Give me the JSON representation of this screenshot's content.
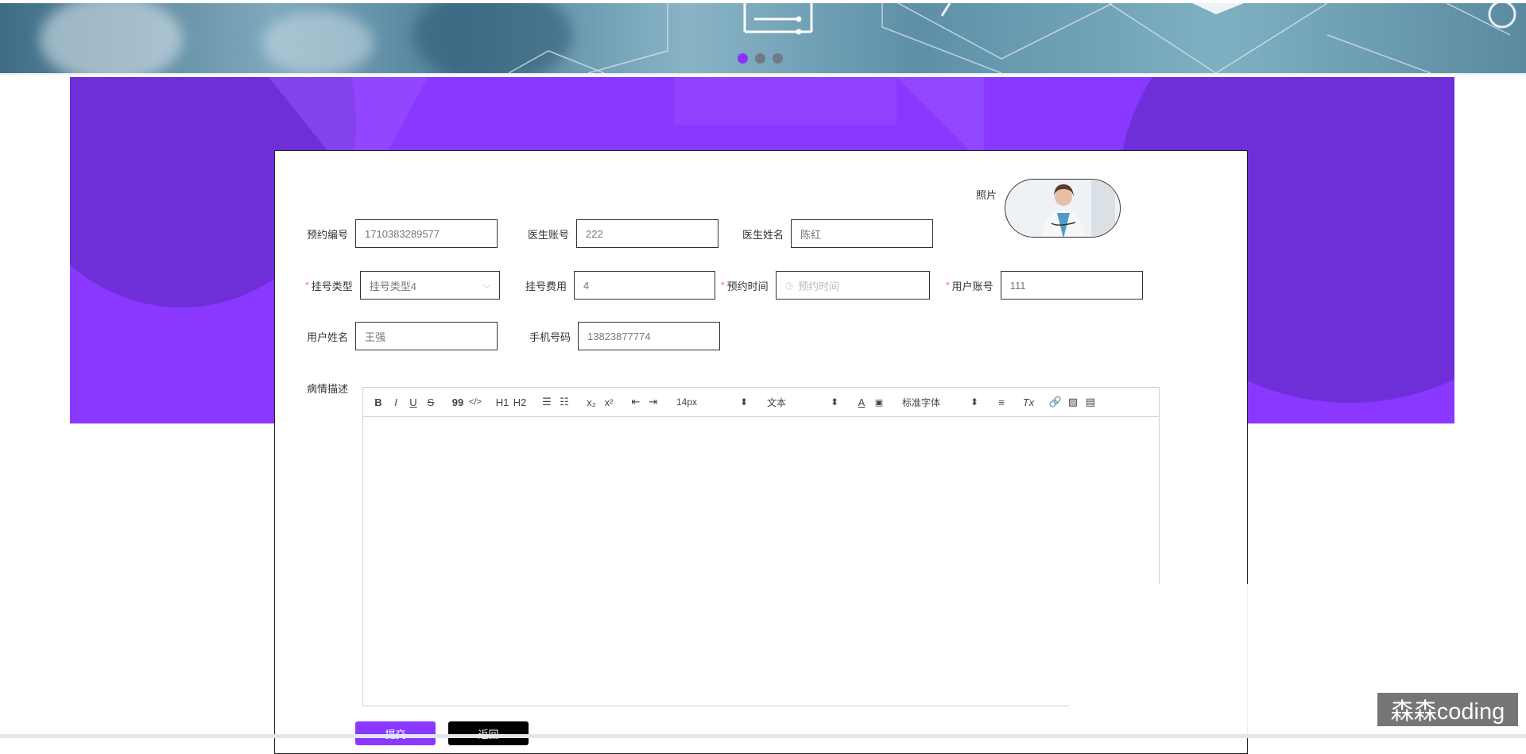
{
  "banner": {
    "carousel": {
      "count": 3,
      "active": 0
    }
  },
  "form": {
    "photo_label": "照片",
    "appointment_no": {
      "label": "预约编号",
      "value": "1710383289577"
    },
    "doctor_account": {
      "label": "医生账号",
      "value": "222"
    },
    "doctor_name": {
      "label": "医生姓名",
      "value": "陈红"
    },
    "reg_type": {
      "label": "挂号类型",
      "value": "挂号类型4",
      "required": true
    },
    "reg_fee": {
      "label": "挂号费用",
      "value": "4"
    },
    "appt_time": {
      "label": "预约时间",
      "placeholder": "预约时间",
      "required": true
    },
    "user_account": {
      "label": "用户账号",
      "value": "111",
      "required": true
    },
    "user_name": {
      "label": "用户姓名",
      "value": "王强"
    },
    "phone": {
      "label": "手机号码",
      "value": "13823877774"
    },
    "description": {
      "label": "病情描述"
    }
  },
  "editor": {
    "toolbar": {
      "bold": "B",
      "italic": "I",
      "underline": "U",
      "strike": "S",
      "quote": "99",
      "code": "</>",
      "h1": "H1",
      "h2": "H2",
      "subscript": "x₂",
      "superscript": "x²",
      "size": "14px",
      "block": "文本",
      "font": "标准字体",
      "clean": "Tx"
    }
  },
  "buttons": {
    "submit": "提交",
    "back": "返回"
  },
  "watermark": "森森coding",
  "colors": {
    "accent": "#8a38ff",
    "required": "#f56c6c"
  }
}
